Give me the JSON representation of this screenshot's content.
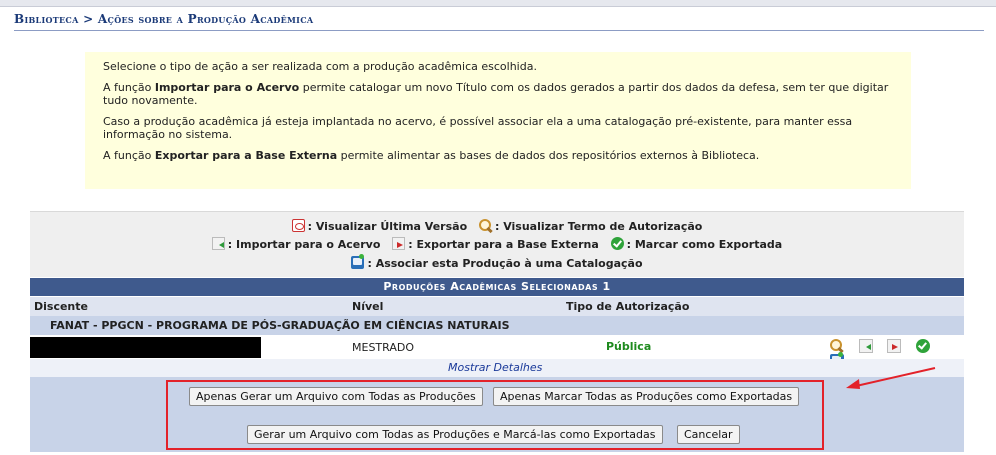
{
  "breadcrumb": "Biblioteca > Ações sobre a Produção Acadêmica",
  "info": {
    "p1": "Selecione o tipo de ação a ser realizada com a produção acadêmica escolhida.",
    "p2_pre": "A função ",
    "p2_bold": "Importar para o Acervo",
    "p2_post": " permite catalogar um novo Título com os dados gerados a partir dos dados da defesa, sem ter que digitar tudo novamente.",
    "p3": "Caso a produção acadêmica já esteja implantada no acervo, é possível associar ela a uma catalogação pré-existente, para manter essa informação no sistema.",
    "p4_pre": "A função ",
    "p4_bold": "Exportar para a Base Externa",
    "p4_post": " permite alimentar as bases de dados dos repositórios externos à Biblioteca."
  },
  "legend": {
    "pdf": ": Visualizar Última Versão",
    "term": ": Visualizar Termo de Autorização",
    "import": ": Importar para o Acervo",
    "export": ": Exportar para a Base Externa",
    "mark": ": Marcar como Exportada",
    "associate": ": Associar esta Produção à uma Catalogação"
  },
  "table": {
    "caption": "Produções Acadêmicas Selecionadas 1",
    "headers": [
      "Discente",
      "Nível",
      "Tipo de Autorização"
    ],
    "group": "FANAT - PPGCN - PROGRAMA DE PÓS-GRADUAÇÃO EM CIÊNCIAS NATURAIS",
    "row": {
      "level": "MESTRADO",
      "authorization": "Pública"
    },
    "details_link": "Mostrar Detalhes"
  },
  "buttons": {
    "generate_all": "Apenas Gerar um Arquivo com Todas as Produções",
    "mark_all": "Apenas Marcar Todas as Produções como Exportadas",
    "generate_and_mark": "Gerar um Arquivo com Todas as Produções e Marcá-las como Exportadas",
    "cancel": "Cancelar"
  },
  "colors": {
    "header_bar": "#3f5a8d",
    "info_bg": "#ffffdd",
    "authorization_public": "#1e8a1e",
    "highlight": "#e3222a"
  },
  "icons": [
    "pdf-icon",
    "magnifier-icon",
    "import-icon",
    "export-icon",
    "check-icon",
    "catalog-book-icon"
  ]
}
